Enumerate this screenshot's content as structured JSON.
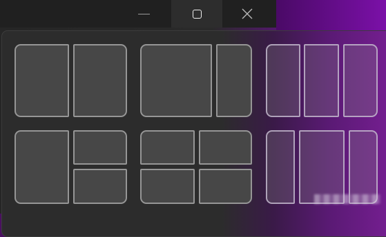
{
  "titlebar": {
    "minimize_icon": "minimize-icon",
    "maximize_icon": "maximize-icon",
    "close_icon": "close-icon",
    "close_glyph": "✕"
  },
  "snap_layouts": {
    "layouts": [
      {
        "name": "two-equal-columns",
        "zones": 2
      },
      {
        "name": "two-columns-wide-left",
        "zones": 2
      },
      {
        "name": "three-equal-columns",
        "zones": 3
      },
      {
        "name": "left-column-two-right-rows",
        "zones": 3
      },
      {
        "name": "four-quadrants",
        "zones": 4
      },
      {
        "name": "three-columns-wide-center",
        "zones": 3
      }
    ]
  },
  "colors": {
    "panel": "#2c2c2c",
    "zone_fill": "#474747",
    "zone_border": "#a5a5a5",
    "wallpaper_accent": "#7b10a8"
  }
}
